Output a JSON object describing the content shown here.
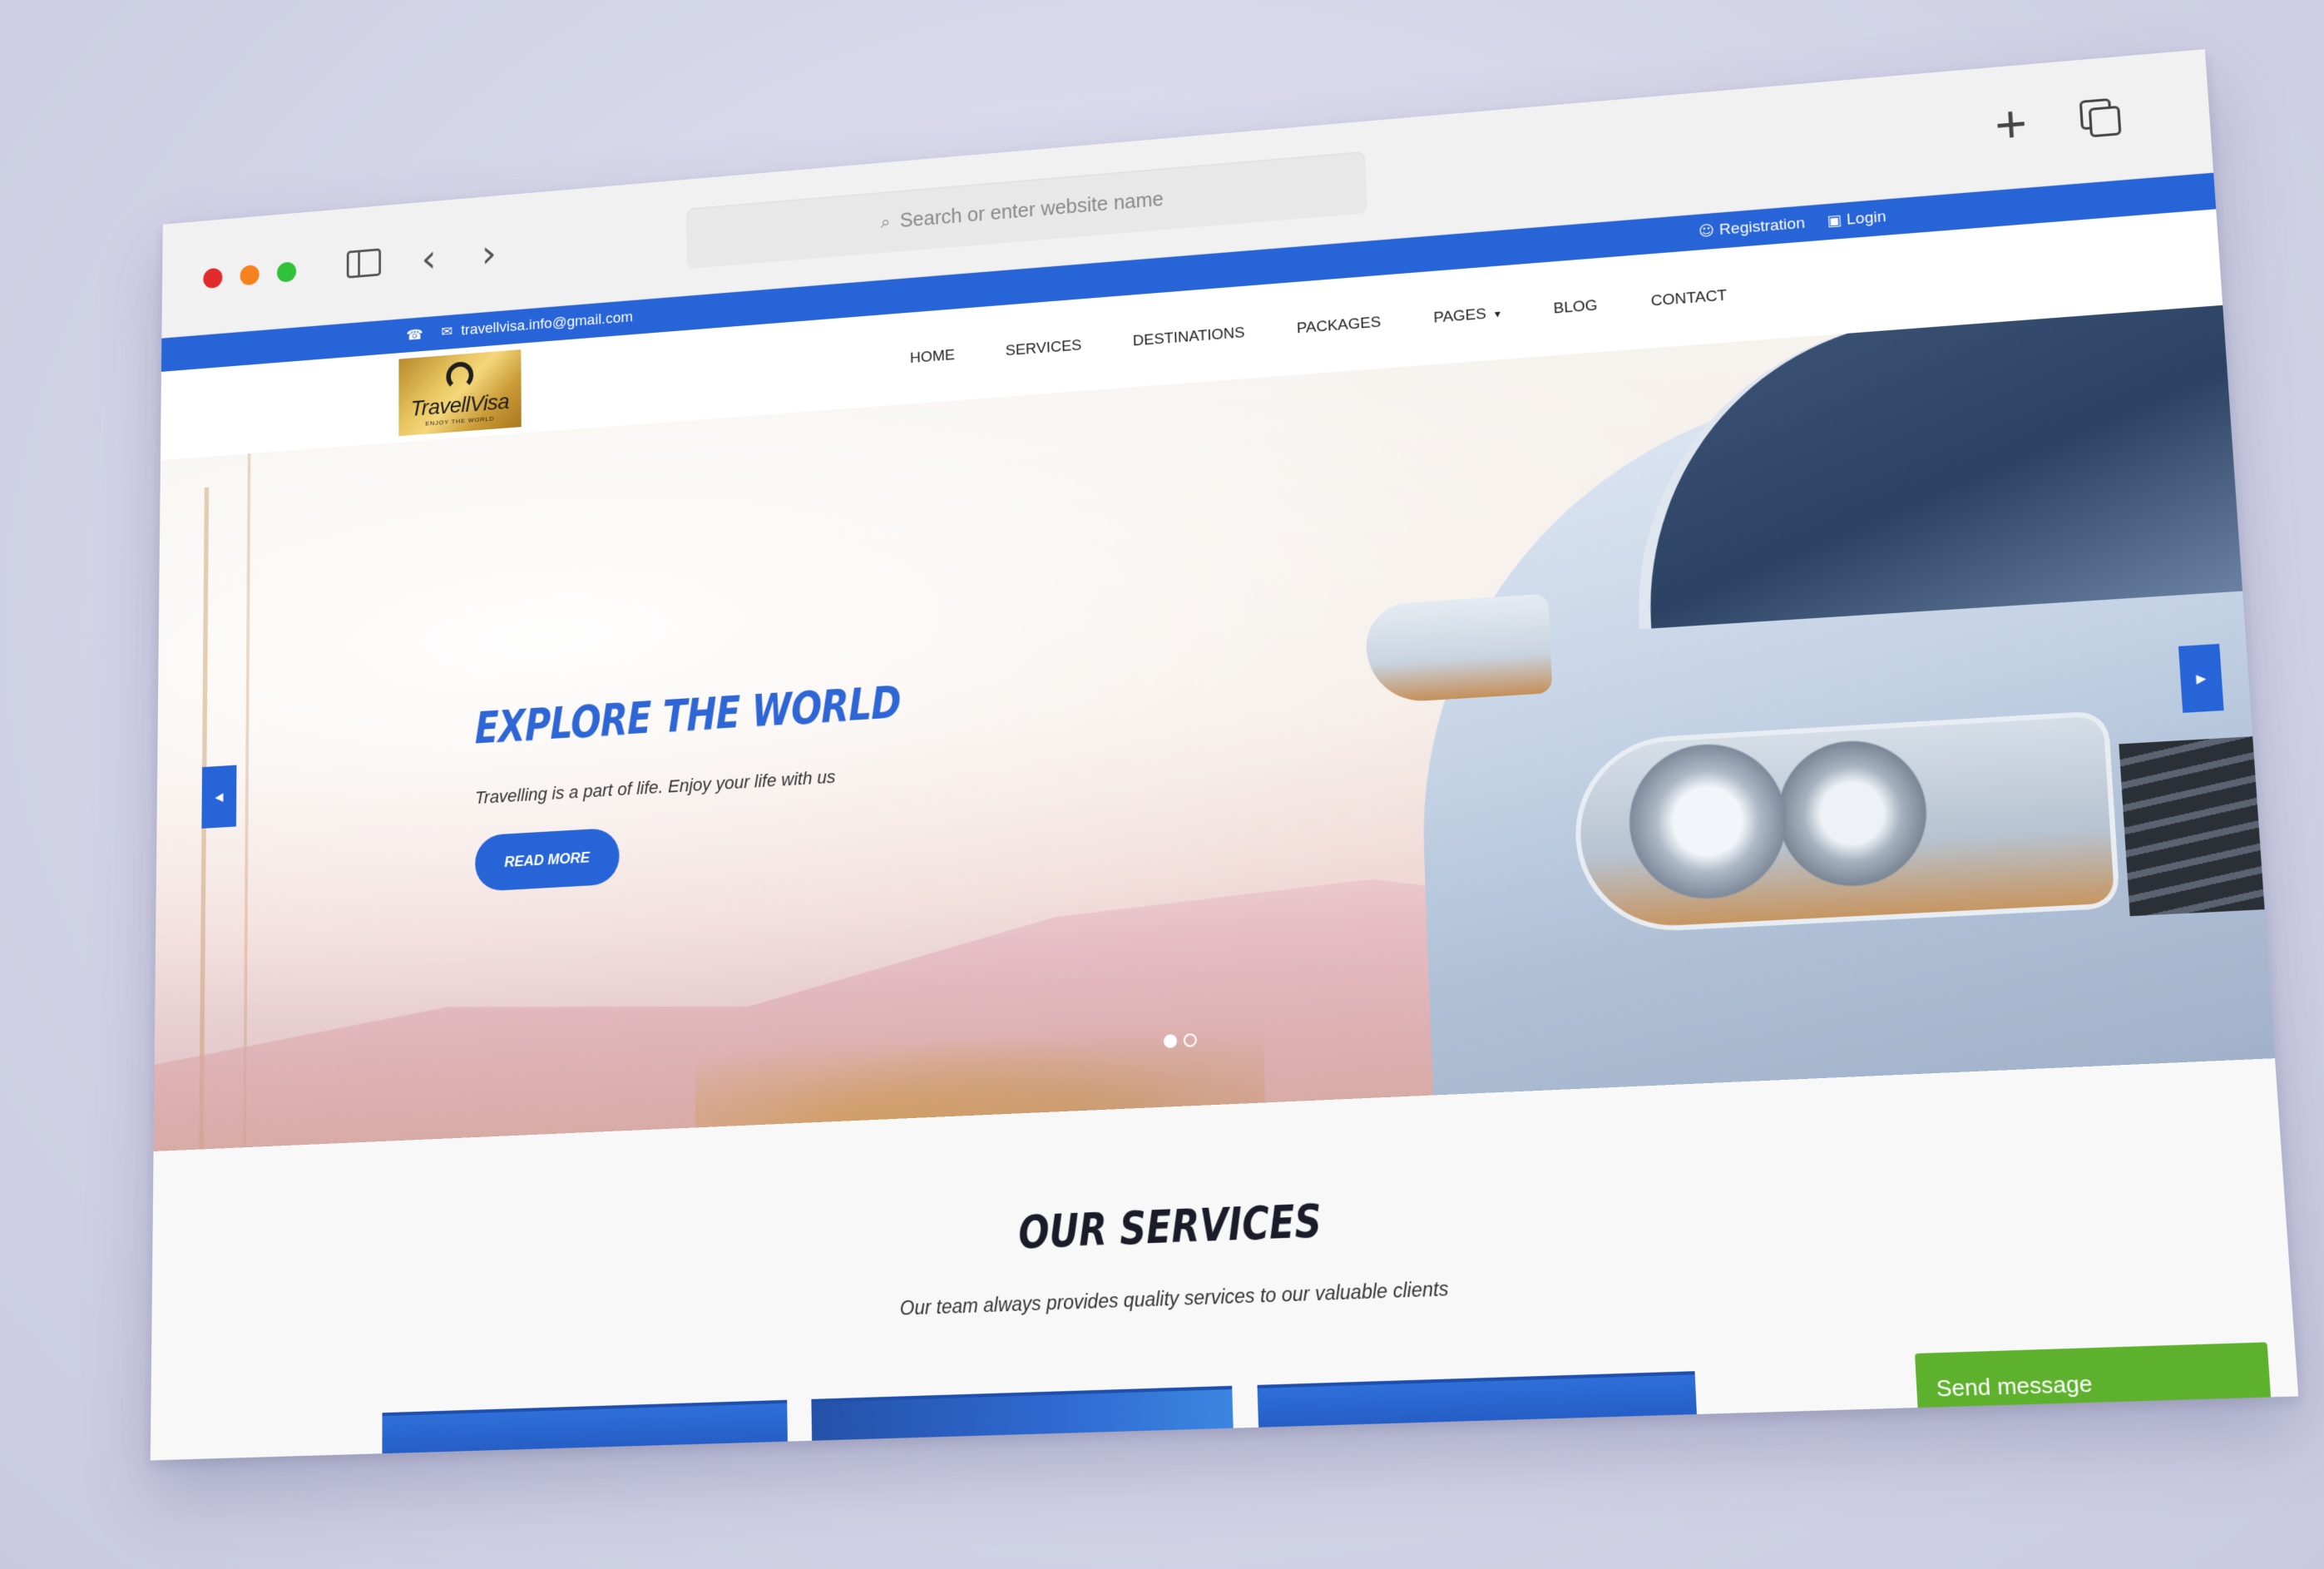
{
  "browser": {
    "address_placeholder": "Search or enter website name"
  },
  "topbar": {
    "email": "travellvisa.info@gmail.com",
    "registration_label": "Registration",
    "login_label": "Login",
    "color": "#2764d8"
  },
  "header": {
    "logo_text": "TravellVisa",
    "logo_tagline": "ENJOY THE WORLD",
    "menu": [
      {
        "label": "HOME"
      },
      {
        "label": "SERVICES"
      },
      {
        "label": "DESTINATIONS"
      },
      {
        "label": "PACKAGES"
      },
      {
        "label": "PAGES"
      },
      {
        "label": "BLOG"
      },
      {
        "label": "CONTACT"
      }
    ]
  },
  "hero": {
    "title": "EXPLORE THE WORLD",
    "subtitle": "Travelling is a part of life. Enjoy your life with us",
    "button_label": "READ MORE",
    "slide_count": 2,
    "active_slide": 1
  },
  "services": {
    "title": "OUR SERVICES",
    "subtitle": "Our team always provides quality services to our valuable clients"
  },
  "chat": {
    "send_message_label": "Send message",
    "color": "#5db12c"
  }
}
